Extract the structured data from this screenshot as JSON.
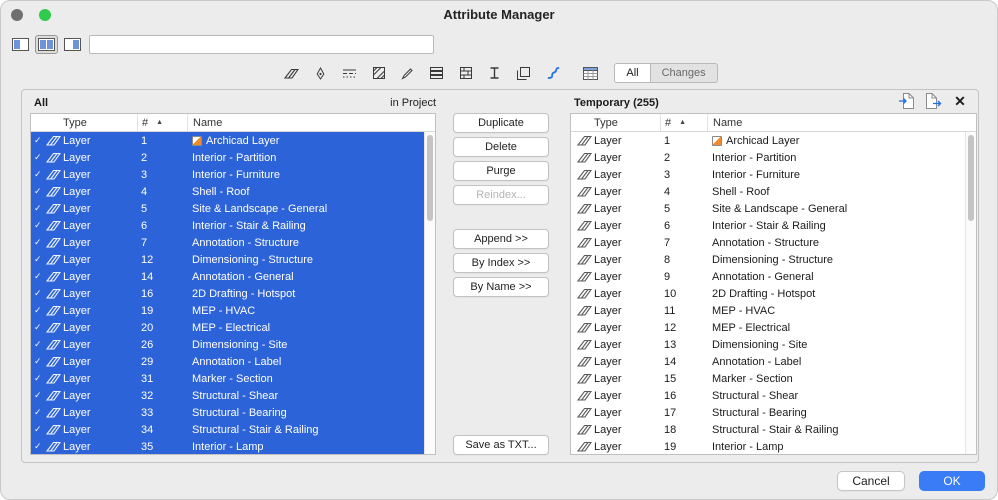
{
  "window": {
    "title": "Attribute Manager"
  },
  "toolbar": {
    "filter_value": "",
    "view_modes": [
      "left-panel-view",
      "dual-panel-view",
      "right-panel-view"
    ]
  },
  "attribute_tabs": {
    "icons": [
      "layers",
      "pens",
      "line-types",
      "fill-types",
      "surfaces",
      "composites",
      "building-materials",
      "profiles",
      "zone-categories",
      "mep-systems"
    ],
    "all_label": "All",
    "changes_label": "Changes"
  },
  "left_panel": {
    "title": "All",
    "source_label": "in Project",
    "columns": {
      "type": "Type",
      "num": "#",
      "name": "Name"
    },
    "rows": [
      {
        "checked": true,
        "type": "Layer",
        "num": "1",
        "name": "Archicad Layer",
        "special_icon": true
      },
      {
        "checked": true,
        "type": "Layer",
        "num": "2",
        "name": "Interior - Partition"
      },
      {
        "checked": true,
        "type": "Layer",
        "num": "3",
        "name": "Interior - Furniture"
      },
      {
        "checked": true,
        "type": "Layer",
        "num": "4",
        "name": "Shell - Roof"
      },
      {
        "checked": true,
        "type": "Layer",
        "num": "5",
        "name": "Site & Landscape - General"
      },
      {
        "checked": true,
        "type": "Layer",
        "num": "6",
        "name": "Interior - Stair & Railing"
      },
      {
        "checked": true,
        "type": "Layer",
        "num": "7",
        "name": "Annotation - Structure"
      },
      {
        "checked": true,
        "type": "Layer",
        "num": "12",
        "name": "Dimensioning - Structure"
      },
      {
        "checked": true,
        "type": "Layer",
        "num": "14",
        "name": "Annotation - General"
      },
      {
        "checked": true,
        "type": "Layer",
        "num": "16",
        "name": "2D Drafting - Hotspot"
      },
      {
        "checked": true,
        "type": "Layer",
        "num": "19",
        "name": "MEP - HVAC"
      },
      {
        "checked": true,
        "type": "Layer",
        "num": "20",
        "name": "MEP - Electrical"
      },
      {
        "checked": true,
        "type": "Layer",
        "num": "26",
        "name": "Dimensioning - Site"
      },
      {
        "checked": true,
        "type": "Layer",
        "num": "29",
        "name": "Annotation - Label"
      },
      {
        "checked": true,
        "type": "Layer",
        "num": "31",
        "name": "Marker - Section"
      },
      {
        "checked": true,
        "type": "Layer",
        "num": "32",
        "name": "Structural - Shear"
      },
      {
        "checked": true,
        "type": "Layer",
        "num": "33",
        "name": "Structural - Bearing"
      },
      {
        "checked": true,
        "type": "Layer",
        "num": "34",
        "name": "Structural - Stair & Railing"
      },
      {
        "checked": true,
        "type": "Layer",
        "num": "35",
        "name": "Interior - Lamp"
      }
    ]
  },
  "actions": {
    "duplicate": "Duplicate",
    "delete": "Delete",
    "purge": "Purge",
    "reindex": "Reindex...",
    "append": "Append >>",
    "by_index": "By Index >>",
    "by_name": "By Name >>",
    "save_txt": "Save as TXT..."
  },
  "right_panel": {
    "title": "Temporary (255)",
    "header_icons": [
      "open-attribute-file",
      "save-attribute-file",
      "close-temporary"
    ],
    "columns": {
      "type": "Type",
      "num": "#",
      "name": "Name"
    },
    "rows": [
      {
        "type": "Layer",
        "num": "1",
        "name": "Archicad Layer",
        "special_icon": true
      },
      {
        "type": "Layer",
        "num": "2",
        "name": "Interior - Partition"
      },
      {
        "type": "Layer",
        "num": "3",
        "name": "Interior - Furniture"
      },
      {
        "type": "Layer",
        "num": "4",
        "name": "Shell - Roof"
      },
      {
        "type": "Layer",
        "num": "5",
        "name": "Site & Landscape - General"
      },
      {
        "type": "Layer",
        "num": "6",
        "name": "Interior - Stair & Railing"
      },
      {
        "type": "Layer",
        "num": "7",
        "name": "Annotation - Structure"
      },
      {
        "type": "Layer",
        "num": "8",
        "name": "Dimensioning - Structure"
      },
      {
        "type": "Layer",
        "num": "9",
        "name": "Annotation - General"
      },
      {
        "type": "Layer",
        "num": "10",
        "name": "2D Drafting - Hotspot"
      },
      {
        "type": "Layer",
        "num": "11",
        "name": "MEP - HVAC"
      },
      {
        "type": "Layer",
        "num": "12",
        "name": "MEP - Electrical"
      },
      {
        "type": "Layer",
        "num": "13",
        "name": "Dimensioning - Site"
      },
      {
        "type": "Layer",
        "num": "14",
        "name": "Annotation - Label"
      },
      {
        "type": "Layer",
        "num": "15",
        "name": "Marker - Section"
      },
      {
        "type": "Layer",
        "num": "16",
        "name": "Structural - Shear"
      },
      {
        "type": "Layer",
        "num": "17",
        "name": "Structural - Bearing"
      },
      {
        "type": "Layer",
        "num": "18",
        "name": "Structural - Stair & Railing"
      },
      {
        "type": "Layer",
        "num": "19",
        "name": "Interior - Lamp"
      }
    ]
  },
  "footer": {
    "cancel": "Cancel",
    "ok": "OK"
  },
  "icons": {
    "checkmark": "✓",
    "sort_ascending": "▲",
    "close_x": "✕"
  },
  "colors": {
    "selection_blue": "#2d63d8",
    "ok_blue": "#3a7bf6"
  }
}
